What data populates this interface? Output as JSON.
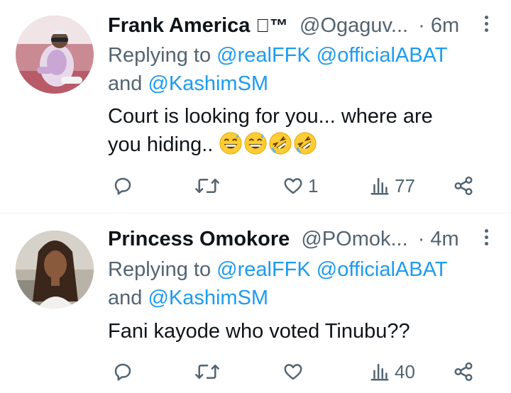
{
  "tweets": [
    {
      "author_name": "Frank America",
      "author_badge": "™",
      "handle": "@Ogaguv...",
      "time": "· 6m",
      "replying_prefix": "Replying to",
      "mention_1": "@realFFK",
      "mention_2": "@officialABAT",
      "reply_and": "and",
      "mention_3": "@KashimSM",
      "text_line_1": "Court is looking for you... where are",
      "text_line_2": "you hiding..",
      "emojis": [
        "grinning-sweat-emoji",
        "grinning-sweat-emoji",
        "rolling-laughing-emoji",
        "rolling-laughing-emoji"
      ],
      "likes": "1",
      "views": "77"
    },
    {
      "author_name": "Princess Omokore",
      "handle": "@POmok...",
      "time": "· 4m",
      "replying_prefix": "Replying to",
      "mention_1": "@realFFK",
      "mention_2": "@officialABAT",
      "reply_and": "and",
      "mention_3": "@KashimSM",
      "text_line_1": "Fani kayode who voted Tinubu??",
      "likes": "",
      "views": "40"
    }
  ],
  "colors": {
    "text": "#0f1419",
    "secondary": "#536471",
    "link": "#1d9bf0",
    "divider": "#eff3f4"
  },
  "icons": [
    "reply-icon",
    "retweet-icon",
    "like-icon",
    "views-icon",
    "share-icon",
    "more-icon"
  ]
}
